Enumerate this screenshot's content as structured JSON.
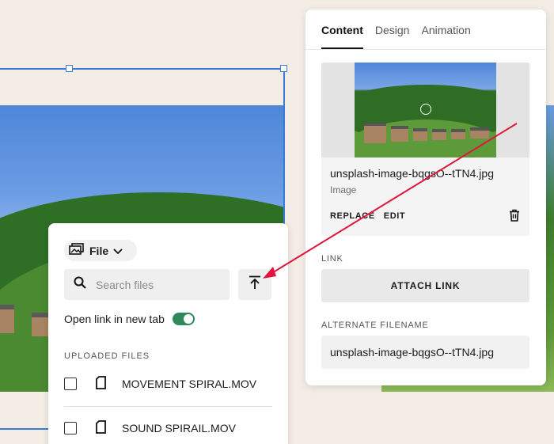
{
  "file_panel": {
    "source_dropdown": {
      "label": "File",
      "icon": "images-icon",
      "chevron": "chevron-down-icon"
    },
    "search": {
      "placeholder": "Search files",
      "value": "",
      "icon": "search-icon"
    },
    "upload_icon": "upload-icon",
    "open_new_tab": {
      "label": "Open link in new tab",
      "enabled": true
    },
    "uploaded_header": "UPLOADED FILES",
    "files": [
      {
        "name": "MOVEMENT SPIRAL.MOV",
        "checked": false,
        "icon": "file-icon"
      },
      {
        "name": "SOUND SPIRAIL.MOV",
        "checked": false,
        "icon": "file-icon"
      }
    ]
  },
  "image_panel": {
    "tabs": [
      {
        "label": "Content",
        "active": true
      },
      {
        "label": "Design",
        "active": false
      },
      {
        "label": "Animation",
        "active": false
      }
    ],
    "image": {
      "filename": "unsplash-image-bqgsO--tTN4.jpg",
      "type_label": "Image",
      "replace_label": "REPLACE",
      "edit_label": "EDIT",
      "delete_icon": "trash-icon"
    },
    "link": {
      "section_label": "LINK",
      "attach_label": "ATTACH LINK"
    },
    "alt_filename": {
      "section_label": "ALTERNATE FILENAME",
      "value": "unsplash-image-bqgsO--tTN4.jpg"
    }
  },
  "colors": {
    "selection": "#3a7bd5",
    "annotation_arrow": "#e0143c",
    "toggle_on": "#2e8a5a",
    "canvas_bg": "#f3ede6"
  }
}
